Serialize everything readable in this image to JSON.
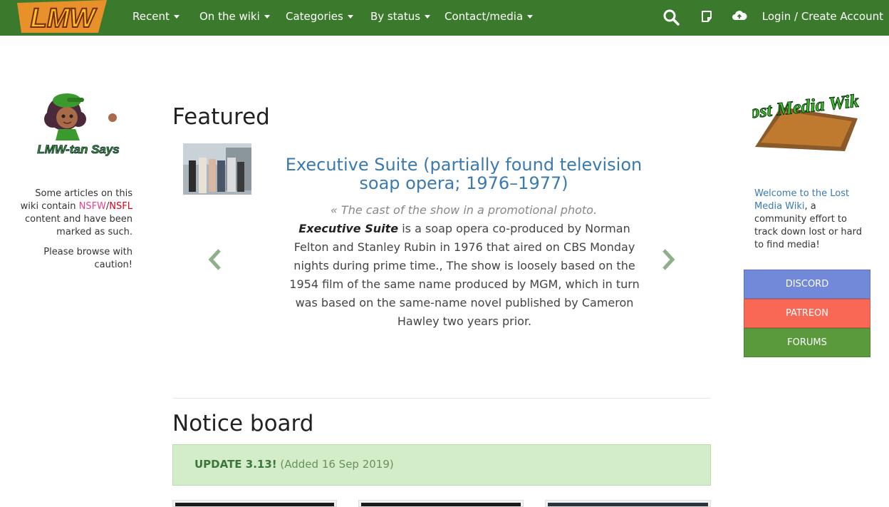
{
  "navbar": {
    "logo_text": "LMW",
    "items": [
      "Recent",
      "On the wiki",
      "Categories",
      "By status",
      "Contact/media"
    ],
    "icons": [
      "search-icon",
      "edit-note-icon",
      "cloud-upload-icon"
    ],
    "login": "Login / Create Account"
  },
  "left": {
    "mascot_text": "LMW-tan Says",
    "warning_pre": "Some articles on this wiki contain",
    "nsfw": "NSFW",
    "slash": "/",
    "nsfl": "NSFL",
    "warning_post": "content and have been marked as such.",
    "caution": "Please browse with caution!"
  },
  "featured": {
    "heading": "Featured",
    "title": "Executive Suite (partially found television soap opera; 1976–1977)",
    "caption": "« The cast of the show in a promotional photo.",
    "body_bold": "Executive Suite",
    "body": "is a soap opera co-produced by Norman Felton and Stanley Rubin in 1976 that aired on CBS Monday nights during prime time., The show is loosely based on the 1954 film of the same name produced by MGM, which in turn was based on the same-name novel published by Cameron Hawley two years prior."
  },
  "notice": {
    "heading": "Notice board",
    "update": "UPDATE 3.13!",
    "added": "(Added 16 Sep 2019)"
  },
  "right": {
    "logo_text": "Lost Media Wiki",
    "welcome_link": "Welcome to the Lost Media Wiki",
    "welcome_rest": ", a community effort to track down lost or hard to find media!",
    "buttons": [
      {
        "label": "DISCORD",
        "color": "#7289da"
      },
      {
        "label": "PATREON",
        "color": "#f96854"
      },
      {
        "label": "FORUMS",
        "color": "#5a9a3c"
      }
    ]
  },
  "colors": {
    "navbar": "#3b7a2c",
    "link": "#3b7ab0",
    "notice_bg": "#d4edc9"
  }
}
